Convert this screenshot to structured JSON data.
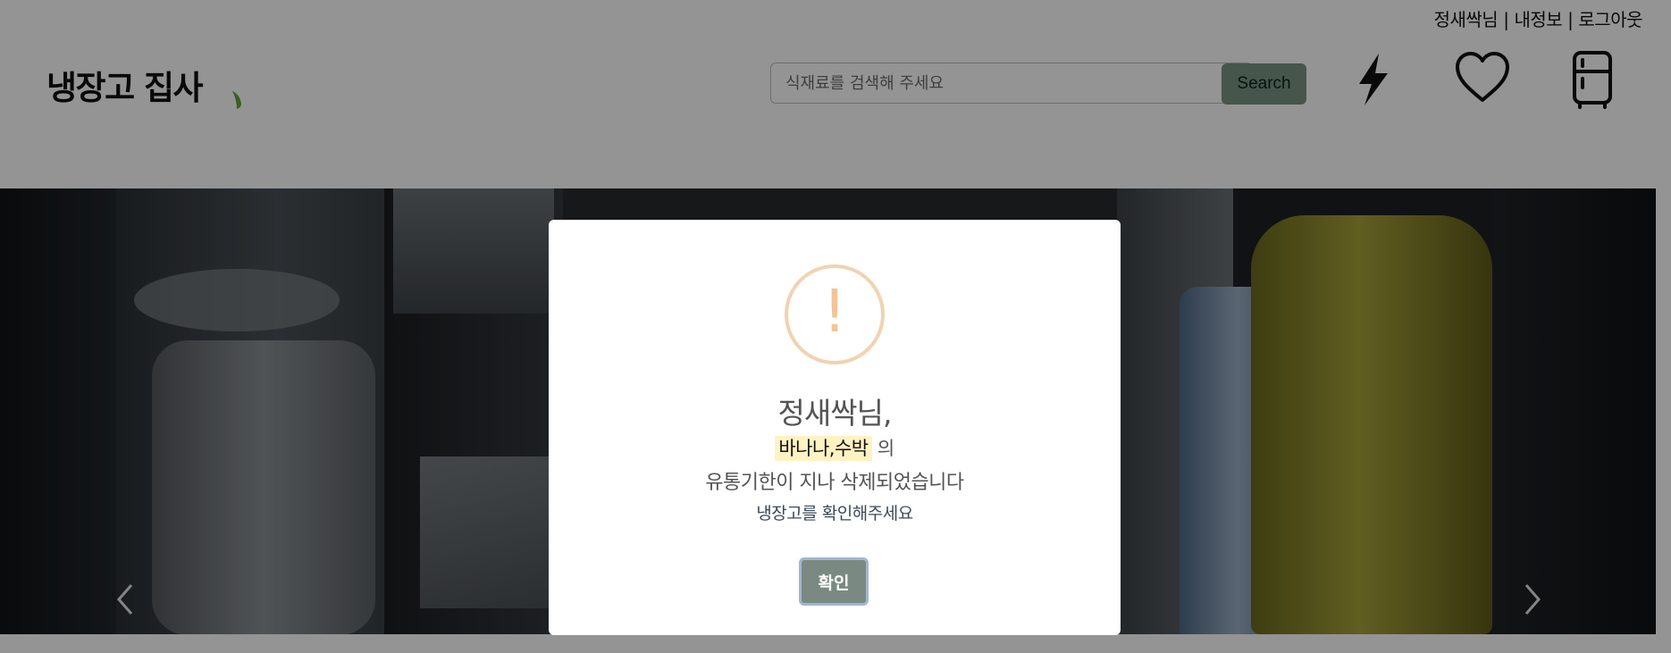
{
  "header": {
    "user_name": "정새싹님",
    "separator": "|",
    "my_info": "내정보",
    "logout": "로그아웃",
    "logo_text": "냉장고 집사",
    "search_placeholder": "식재료를 검색해 주세요",
    "search_button": "Search",
    "icons": [
      "lightning-icon",
      "heart-icon",
      "fridge-icon"
    ]
  },
  "carousel": {
    "prev_icon": "chevron-left-icon",
    "next_icon": "chevron-right-icon"
  },
  "modal": {
    "icon": "warning-icon",
    "icon_glyph": "!",
    "title": "정새싹님,",
    "items": "바나나,수박",
    "items_suffix": "의",
    "message_line1": "유통기한이 지나 삭제되었습니다",
    "message_line2": "냉장고를 확인해주세요",
    "confirm_button": "확인"
  },
  "colors": {
    "accent_button": "#7a9486",
    "warning_ring": "#f2d3b1",
    "highlight": "#fff3c4",
    "overlay": "rgba(0,0,0,0.42)"
  }
}
